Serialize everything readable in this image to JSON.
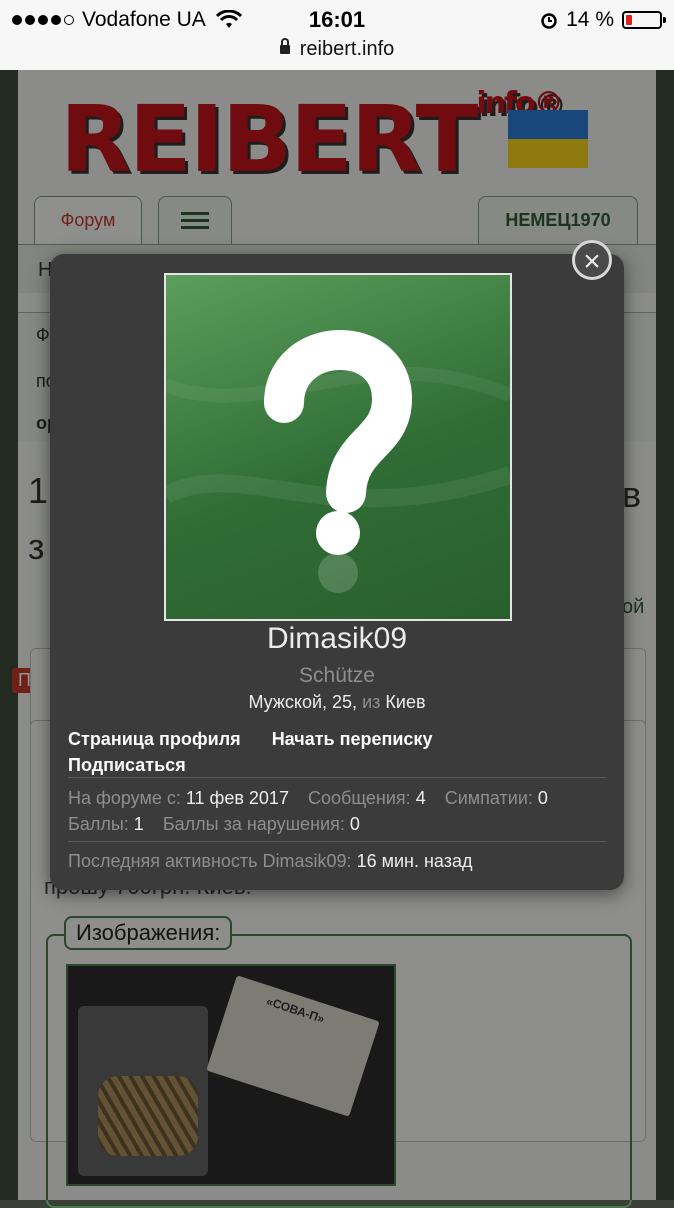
{
  "status_bar": {
    "carrier": "Vodafone UA",
    "time": "16:01",
    "battery": "14 %",
    "url": "reibert.info"
  },
  "site": {
    "logo": "REIBERT",
    "logo_suffix": "info",
    "logo_mark": "®",
    "tabs": {
      "forum": "Форум",
      "user": "НЕМЕЦ1970"
    },
    "bg_fragments": {
      "nav_left": "Н",
      "crumb_1": "Ф",
      "crumb_2": "по",
      "crumb_3": "ор",
      "heading_1": "1",
      "heading_2": "з",
      "heading_right": "в",
      "right_link": "ой",
      "badge": "Пр"
    },
    "post_text": "прошу 700грн. Киев.",
    "images_label": "Изображения:",
    "thumb_text": "«СОВА-П»"
  },
  "profile_popup": {
    "username": "Dimasik09",
    "user_title": "Schütze",
    "gender_age": "Мужской, 25,",
    "from_word": "из",
    "location": "Киев",
    "links": {
      "profile": "Страница профиля",
      "message": "Начать переписку",
      "follow": "Подписаться"
    },
    "stats": {
      "joined_label": "На форуме с:",
      "joined_value": "11 фев 2017",
      "messages_label": "Сообщения:",
      "messages_value": "4",
      "likes_label": "Симпатии:",
      "likes_value": "0",
      "points_label": "Баллы:",
      "points_value": "1",
      "warn_label": "Баллы за нарушения:",
      "warn_value": "0",
      "last_label": "Последняя активность Dimasik09:",
      "last_value": "16 мин. назад"
    }
  },
  "colors": {
    "brand_red": "#c2161a",
    "forum_green": "#2e5b33",
    "modal_bg": "#3b3b3b",
    "avatar_green": "#2f6d35"
  }
}
